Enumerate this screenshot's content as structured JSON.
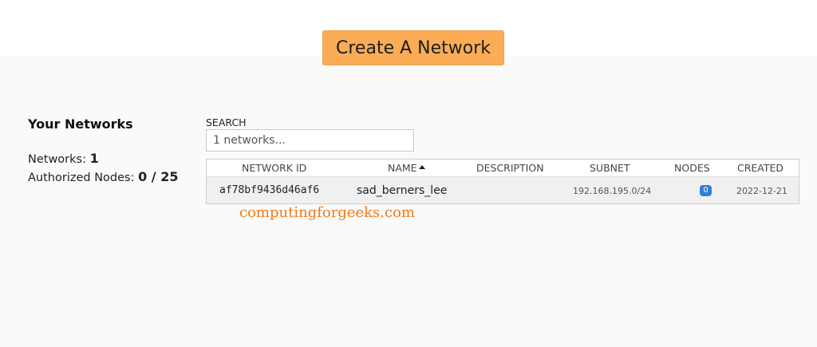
{
  "header": {
    "create_button_label": "Create A Network"
  },
  "sidebar": {
    "title": "Your Networks",
    "networks_label": "Networks:",
    "networks_count": "1",
    "authorized_label": "Authorized Nodes:",
    "authorized_value": "0 / 25"
  },
  "search": {
    "label": "SEARCH",
    "placeholder": "1 networks..."
  },
  "table": {
    "columns": [
      "NETWORK ID",
      "NAME",
      "DESCRIPTION",
      "SUBNET",
      "NODES",
      "CREATED"
    ],
    "sort_column": "NAME",
    "rows": [
      {
        "network_id": "af78bf9436d46af6",
        "name": "sad_berners_lee",
        "description": "",
        "subnet": "192.168.195.0/24",
        "nodes": "0",
        "created": "2022-12-21"
      }
    ]
  },
  "watermark": "computingforgeeks.com",
  "colors": {
    "create_button": "#fbac55",
    "nodes_badge": "#2f7fd8",
    "watermark": "#f07a1a"
  }
}
